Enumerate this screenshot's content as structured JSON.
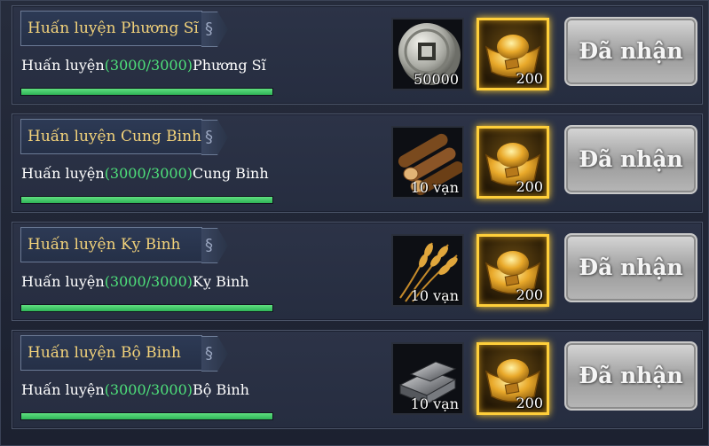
{
  "tasks": [
    {
      "title": "Huấn luyện Phương Sĩ",
      "desc_prefix": "Huấn luyện",
      "desc_count": "(3000/3000)",
      "desc_suffix": "Phương Sĩ",
      "progress": 1.0,
      "reward1_icon": "silver-coin-icon",
      "reward1_qty": "50000",
      "reward2_icon": "gold-ingot-icon",
      "reward2_qty": "200",
      "button_label": "Đã nhận"
    },
    {
      "title": "Huấn luyện Cung Binh",
      "desc_prefix": "Huấn luyện",
      "desc_count": "(3000/3000)",
      "desc_suffix": "Cung Binh",
      "progress": 1.0,
      "reward1_icon": "wood-logs-icon",
      "reward1_qty": "10 vạn",
      "reward2_icon": "gold-ingot-icon",
      "reward2_qty": "200",
      "button_label": "Đã nhận"
    },
    {
      "title": "Huấn luyện Kỵ Binh",
      "desc_prefix": "Huấn luyện",
      "desc_count": "(3000/3000)",
      "desc_suffix": "Kỵ Binh",
      "progress": 1.0,
      "reward1_icon": "wheat-icon",
      "reward1_qty": "10 vạn",
      "reward2_icon": "gold-ingot-icon",
      "reward2_qty": "200",
      "button_label": "Đã nhận"
    },
    {
      "title": "Huấn luyện Bộ Binh",
      "desc_prefix": "Huấn luyện",
      "desc_count": "(3000/3000)",
      "desc_suffix": "Bộ Binh",
      "progress": 1.0,
      "reward1_icon": "iron-ingot-icon",
      "reward1_qty": "10 vạn",
      "reward2_icon": "gold-ingot-icon",
      "reward2_qty": "200",
      "button_label": "Đã nhận"
    }
  ],
  "colors": {
    "title_gold": "#f2d27a",
    "count_green": "#4ee07a",
    "progress_green": "#3fc867",
    "highlight_gold": "#ffcf3a"
  }
}
